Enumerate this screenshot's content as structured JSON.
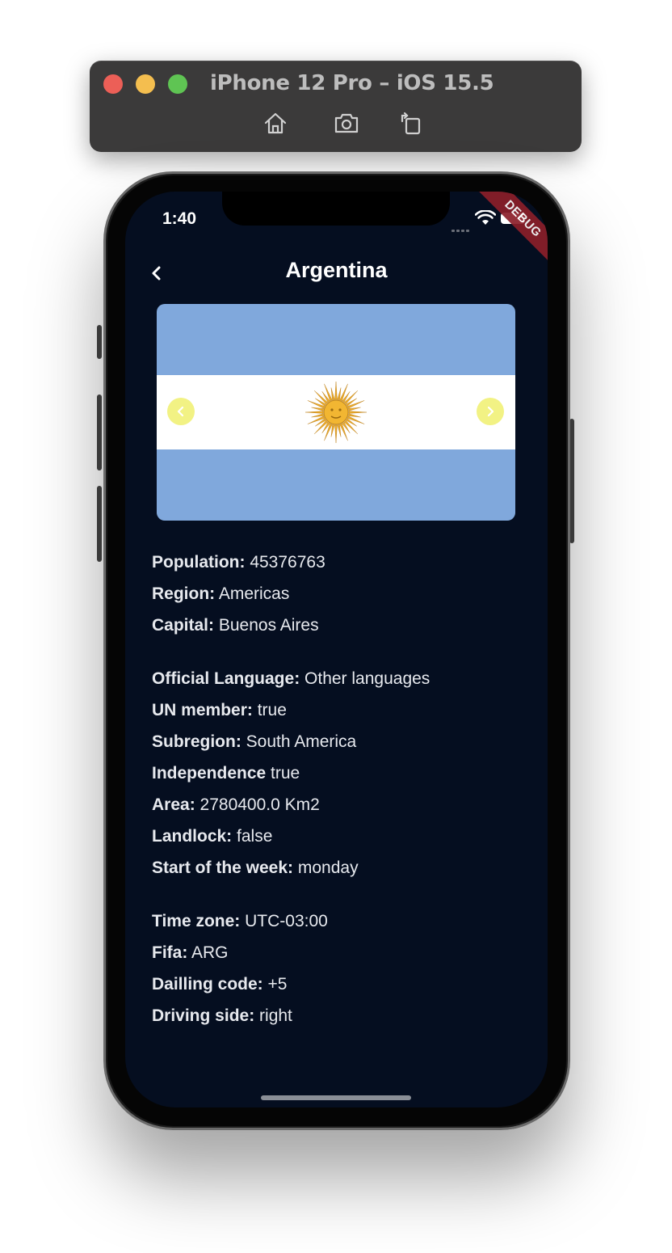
{
  "simulator": {
    "title": "iPhone 12 Pro – iOS 15.5",
    "buttons": [
      "home-icon",
      "camera-icon",
      "rotate-icon"
    ]
  },
  "status_bar": {
    "time": "1:40",
    "debug_banner": "DEBUG"
  },
  "header": {
    "title": "Argentina"
  },
  "flag_carousel": {
    "colors": {
      "sky_blue": "#80a8dc",
      "white": "#ffffff",
      "sun": "#f2b632",
      "nav": "#f0f06e"
    }
  },
  "details": [
    {
      "key": "Population:",
      "value": " 45376763"
    },
    {
      "key": "Region:",
      "value": " Americas"
    },
    {
      "key": "Capital:",
      "value": " Buenos Aires"
    },
    {
      "key": "Official Language:",
      "value": " Other languages"
    },
    {
      "key": "UN member:",
      "value": " true"
    },
    {
      "key": "Subregion:",
      "value": " South America"
    },
    {
      "key": "Independence",
      "value": " true"
    },
    {
      "key": "Area:",
      "value": " 2780400.0 Km2"
    },
    {
      "key": "Landlock:",
      "value": " false"
    },
    {
      "key": "Start of the week:",
      "value": " monday"
    },
    {
      "key": "Time zone:",
      "value": " UTC-03:00"
    },
    {
      "key": "Fifa:",
      "value": " ARG"
    },
    {
      "key": "Dailling code:",
      "value": " +5"
    },
    {
      "key": "Driving side:",
      "value": " right"
    }
  ],
  "theme": {
    "background": "#050e20",
    "text": "#e7e9ee"
  }
}
